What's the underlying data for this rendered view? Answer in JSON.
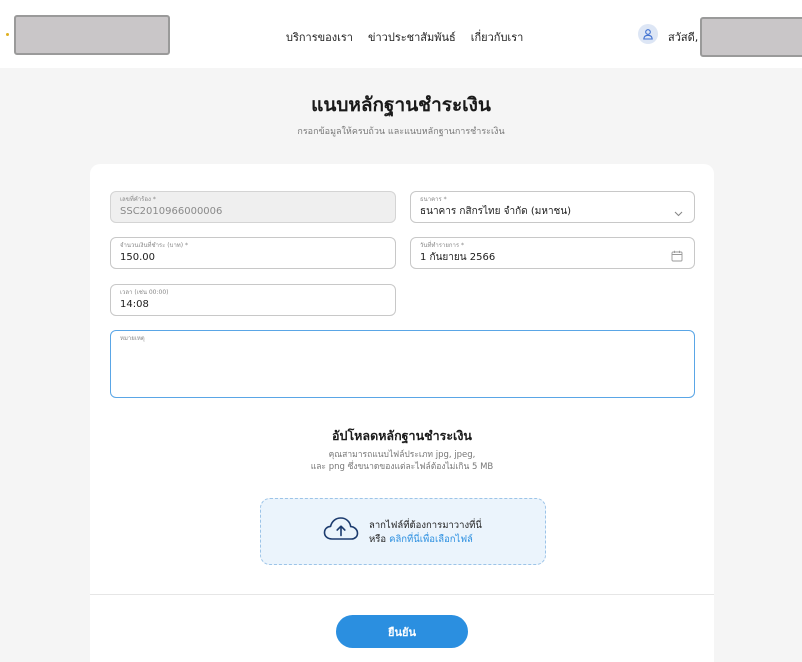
{
  "header": {
    "nav": [
      "บริการของเรา",
      "ข่าวประชาสัมพันธ์",
      "เกี่ยวกับเรา"
    ],
    "greeting": "สวัสดี,"
  },
  "page": {
    "title": "แนบหลักฐานชำระเงิน",
    "subtitle": "กรอกข้อมูลให้ครบถ้วน และแนบหลักฐานการชำระเงิน"
  },
  "form": {
    "request_no": {
      "label": "เลขที่คำร้อง *",
      "value": "SSC2010966000006"
    },
    "bank": {
      "label": "ธนาคาร *",
      "value": "ธนาคาร กสิกรไทย จำกัด (มหาชน)"
    },
    "amount": {
      "label": "จำนวนเงินที่ชำระ (บาท) *",
      "value": "150.00"
    },
    "date": {
      "label": "วันที่ทำรายการ *",
      "value": "1 กันยายน 2566"
    },
    "time": {
      "label": "เวลา (เช่น 00:00)",
      "value": "14:08"
    },
    "note": {
      "label": "หมายเหตุ",
      "value": ""
    }
  },
  "upload": {
    "title": "อัปโหลดหลักฐานชำระเงิน",
    "desc_line1": "คุณสามารถแนบไฟล์ประเภท jpg, jpeg,",
    "desc_line2": "และ png ซึ่งขนาดของแต่ละไฟล์ต้องไม่เกิน 5 MB",
    "drop_text": "ลากไฟล์ที่ต้องการมาวางที่นี่",
    "or_text": "หรือ",
    "browse_link": "คลิกที่นี่เพื่อเลือกไฟล์"
  },
  "actions": {
    "confirm": "ยืนยัน"
  },
  "colors": {
    "accent": "#2b8fe0",
    "dropzone_bg": "#ebf4fc"
  }
}
